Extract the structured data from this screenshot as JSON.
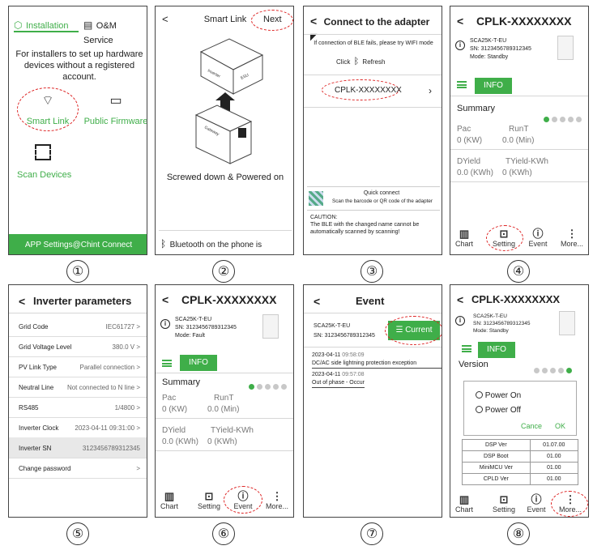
{
  "p1": {
    "tab1": "Installation",
    "tab2": "O&M Service",
    "desc": "For installers to set up hardware devices without a registered account.",
    "smart_link": "Smart Link",
    "public_fw": "Public Firmware",
    "scan": "Scan Devices",
    "footer": "APP Settings@Chint Connect",
    "num": "①"
  },
  "p2": {
    "back": "<",
    "title": "Smart Link",
    "next": "Next",
    "inverter": "Inverter",
    "esu": "ESU",
    "gateway": "Gateway",
    "caption": "Screwed down & Powered on",
    "bt": "Bluetooth on the phone is enabled.",
    "num": "②"
  },
  "p3": {
    "title": "Connect to the adapter",
    "hint": "If connection of BLE fails, please try WIFI mode",
    "click": "Click",
    "refresh": "Refresh",
    "device": "CPLK-XXXXXXXX",
    "qc1": "Quick connect",
    "qc2": "Scan the barcode or QR code of the adapter",
    "caution": "CAUTION:",
    "caution_text": "The BLE with the changed name cannot be automatically scanned by scanning!",
    "num": "③"
  },
  "dev": {
    "title": "CPLK-XXXXXXXX",
    "model": "SCA25K-T-EU",
    "sn": "SN: 3123456789312345",
    "mode_standby": "Mode: Standby",
    "mode_fault": "Mode: Fault",
    "info": "INFO",
    "summary": "Summary",
    "pac": "Pac",
    "runt": "RunT",
    "pac_v": "0 (KW)",
    "runt_v": "0.0 (Min)",
    "dyield": "DYield",
    "tyield": "TYield-KWh",
    "dyield_v": "0.0 (KWh)",
    "tyield_v": "0 (KWh)",
    "chart": "Chart",
    "setting": "Setting",
    "event": "Event",
    "more": "More..."
  },
  "p4": {
    "num": "④"
  },
  "p5": {
    "title": "Inverter parameters",
    "rows": [
      {
        "l": "Grid Code",
        "r": "IEC61727 >"
      },
      {
        "l": "Grid Voltage Level",
        "r": "380.0 V >"
      },
      {
        "l": "PV Link Type",
        "r": "Parallel connection >"
      },
      {
        "l": "Neutral Line",
        "r": "Not connected to N line >"
      },
      {
        "l": "RS485",
        "r": "1/4800 >"
      },
      {
        "l": "Inverter Clock",
        "r": "2023-04-11 09:31:00 >"
      },
      {
        "l": "Inverter SN",
        "r": "3123456789312345"
      },
      {
        "l": "Change password",
        "r": ">"
      }
    ],
    "num": "⑤"
  },
  "p6": {
    "num": "⑥"
  },
  "p7": {
    "title": "Event",
    "current": "Current",
    "e1_date": "2023-04-11",
    "e1_time": "09:58:09",
    "e1_text": "DC/AC side lightning protection exception",
    "e2_date": "2023-04-11",
    "e2_time": "09:57:08",
    "e2_text": "Out of phase - Occur",
    "num": "⑦"
  },
  "p8": {
    "version": "Version",
    "power_on": "Power On",
    "power_off": "Power Off",
    "cancel": "Cance",
    "ok": "OK",
    "ver_rows": [
      {
        "k": "DSP Ver",
        "v": "01.07.00"
      },
      {
        "k": "DSP Boot",
        "v": "01.00"
      },
      {
        "k": "MiniMCU Ver",
        "v": "01.00"
      },
      {
        "k": "CPLD Ver",
        "v": "01.00"
      }
    ],
    "num": "⑧"
  },
  "colors": {
    "green": "#3fae49",
    "red": "#dd2222"
  }
}
